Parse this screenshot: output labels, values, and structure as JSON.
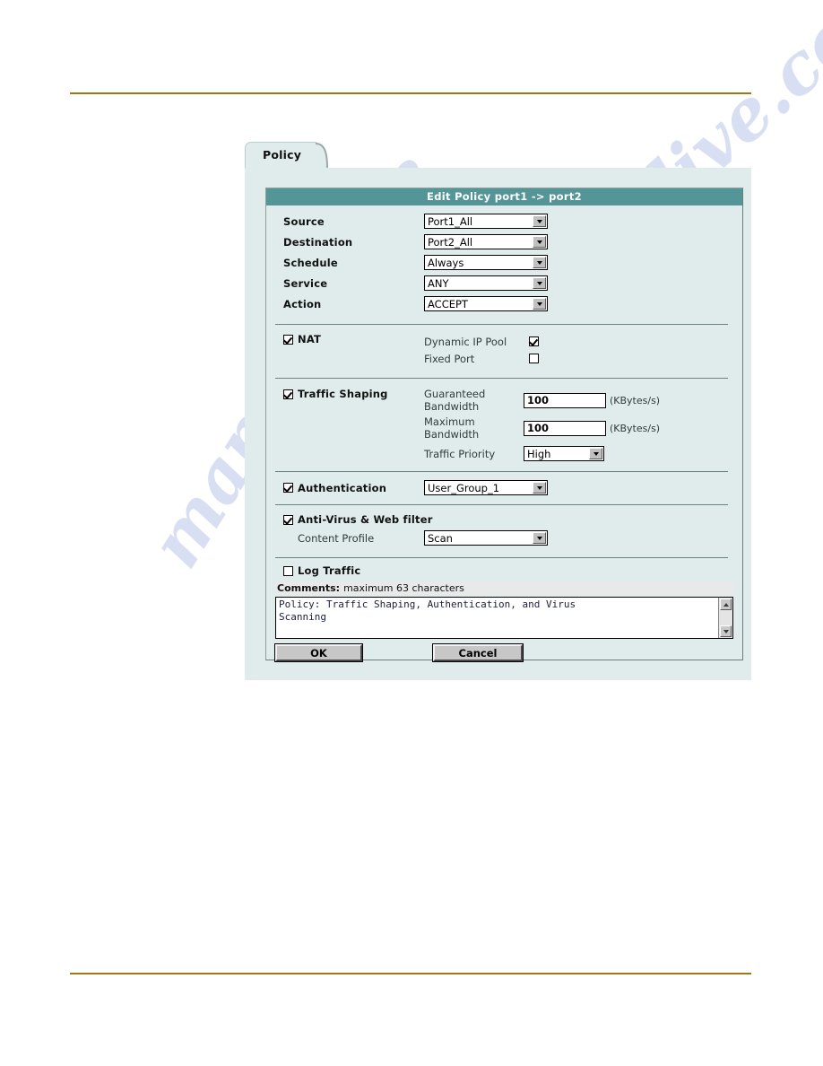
{
  "watermark": {
    "line1": "manualslive.com",
    "line2": "manualslive"
  },
  "tab": {
    "label": "Policy"
  },
  "dialog": {
    "title": "Edit Policy port1 -> port2",
    "fields": [
      {
        "label": "Source",
        "value": "Port1_All"
      },
      {
        "label": "Destination",
        "value": "Port2_All"
      },
      {
        "label": "Schedule",
        "value": "Always"
      },
      {
        "label": "Service",
        "value": "ANY"
      },
      {
        "label": "Action",
        "value": "ACCEPT"
      }
    ],
    "nat": {
      "label": "NAT",
      "checked": true,
      "options": [
        {
          "label": "Dynamic IP Pool",
          "checked": true
        },
        {
          "label": "Fixed Port",
          "checked": false
        }
      ]
    },
    "traffic_shaping": {
      "label": "Traffic Shaping",
      "checked": true,
      "guaranteed_label": "Guaranteed\nBandwidth",
      "guaranteed_label_line1": "Guaranteed",
      "guaranteed_label_line2": "Bandwidth",
      "guaranteed_value": "100",
      "guaranteed_unit": "(KBytes/s)",
      "maximum_label_line1": "Maximum",
      "maximum_label_line2": "Bandwidth",
      "maximum_value": "100",
      "maximum_unit": "(KBytes/s)",
      "priority_label": "Traffic Priority",
      "priority_value": "High"
    },
    "authentication": {
      "label": "Authentication",
      "checked": true,
      "group_value": "User_Group_1"
    },
    "antivirus": {
      "label": "Anti-Virus & Web filter",
      "checked": true,
      "content_profile_label": "Content Profile",
      "content_profile_value": "Scan"
    },
    "log_traffic": {
      "label": "Log Traffic",
      "checked": false
    },
    "comments": {
      "label": "Comments:",
      "hint": "maximum 63 characters",
      "value": "Policy: Traffic Shaping, Authentication, and Virus\nScanning"
    },
    "buttons": {
      "ok": "OK",
      "cancel": "Cancel"
    },
    "colors": {
      "titlebar": "#549598",
      "panel": "#dfeceb",
      "rule": "#9c7916"
    }
  }
}
